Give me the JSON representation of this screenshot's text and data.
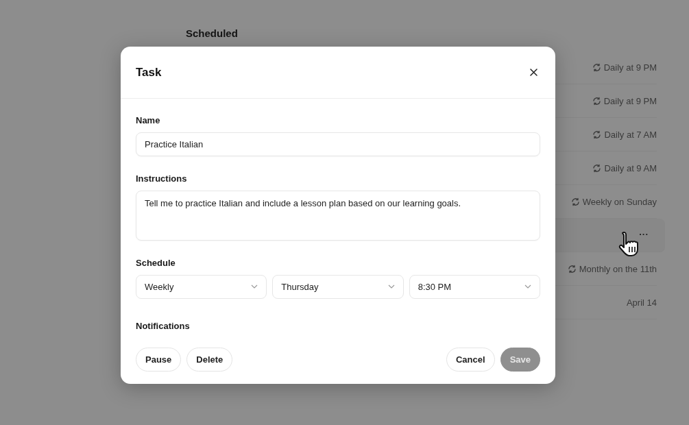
{
  "page": {
    "title": "Scheduled"
  },
  "tasks": [
    {
      "kind": "recurring",
      "schedule": "Daily at 9 PM",
      "hovered": false
    },
    {
      "kind": "recurring",
      "schedule": "Daily at 9 PM",
      "hovered": false
    },
    {
      "kind": "recurring",
      "schedule": "Daily at 7 AM",
      "hovered": false
    },
    {
      "kind": "recurring",
      "schedule": "Daily at 9 AM",
      "hovered": false
    },
    {
      "kind": "recurring",
      "schedule": "Weekly on Sunday",
      "hovered": false
    },
    {
      "kind": "none",
      "hovered": true,
      "menu": "..."
    },
    {
      "kind": "recurring",
      "schedule": "Monthly on the 11th",
      "hovered": false
    },
    {
      "kind": "date",
      "schedule": "April 14",
      "hovered": false
    }
  ],
  "dialog": {
    "title": "Task",
    "name": {
      "label": "Name",
      "value": "Practice Italian"
    },
    "instructions": {
      "label": "Instructions",
      "value": "Tell me to practice Italian and include a lesson plan based on our learning goals."
    },
    "schedule": {
      "label": "Schedule",
      "selects": [
        "Weekly",
        "Thursday",
        "8:30 PM"
      ]
    },
    "notifications": {
      "label": "Notifications"
    },
    "left_buttons": [
      "Pause",
      "Delete"
    ],
    "right_buttons": [
      {
        "label": "Cancel",
        "disabled": false
      },
      {
        "label": "Save",
        "disabled": true
      }
    ]
  }
}
